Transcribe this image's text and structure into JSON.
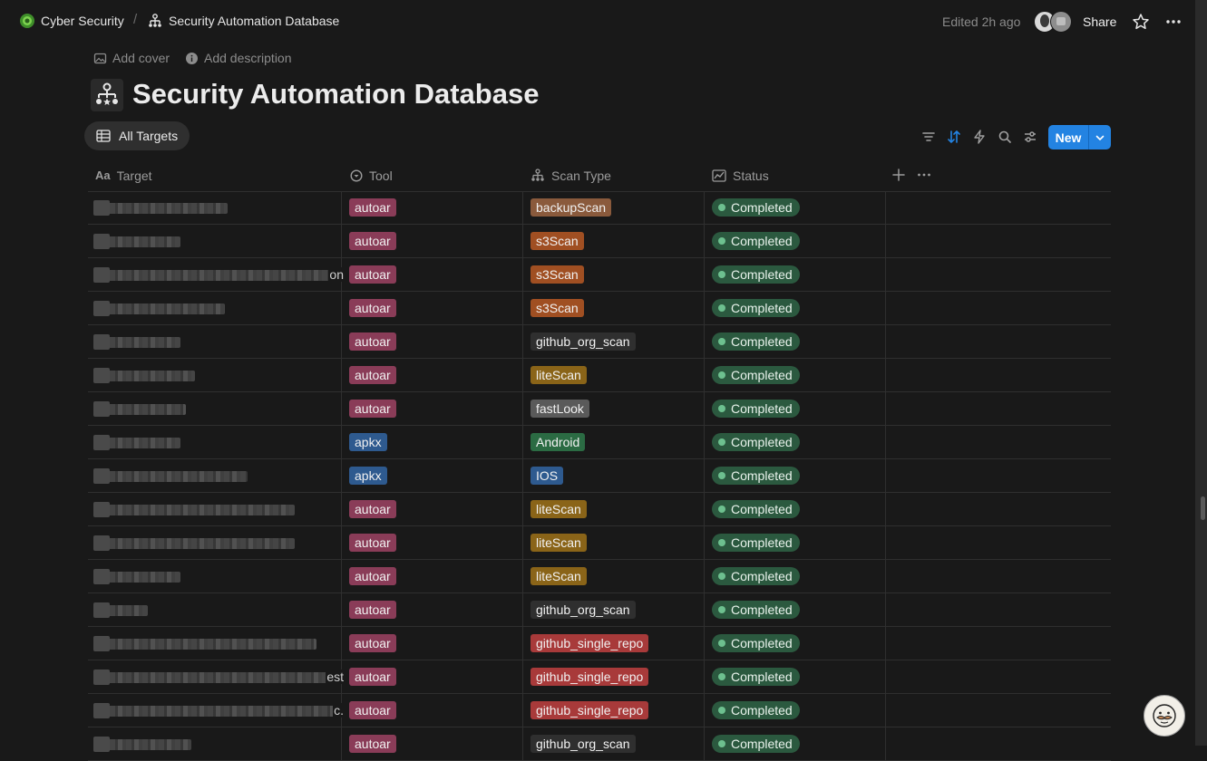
{
  "breadcrumb": {
    "workspace": "Cyber Security",
    "separator": "/",
    "page": "Security Automation Database"
  },
  "topbar": {
    "edited": "Edited 2h ago",
    "share": "Share"
  },
  "header": {
    "add_cover": "Add cover",
    "add_description": "Add description",
    "title": "Security Automation Database"
  },
  "view": {
    "tab_label": "All Targets",
    "new_label": "New"
  },
  "columns": {
    "target": "Target",
    "target_icon_text": "Aa",
    "tool": "Tool",
    "scan_type": "Scan Type",
    "status": "Status"
  },
  "colors": {
    "accent": "#2383e2",
    "tool_autoar": "#8a3c58",
    "tool_apkx": "#2e5a8f",
    "scan_brown": "#8a5a3c",
    "scan_orange": "#a04f22",
    "scan_gray": "#2f2f2f",
    "scan_yellow": "#8a6418",
    "scan_dark": "#5a5a5a",
    "scan_green": "#2b6b43",
    "scan_blue": "#2e5a8f",
    "scan_red": "#a83a3a",
    "status_green": "#2b593f"
  },
  "rows": [
    {
      "target_visible": "",
      "tool": "autoar",
      "tool_color": "tool_autoar",
      "scan": "backupScan",
      "scan_color": "scan_brown",
      "status": "Completed"
    },
    {
      "target_visible": "",
      "tool": "autoar",
      "tool_color": "tool_autoar",
      "scan": "s3Scan",
      "scan_color": "scan_orange",
      "status": "Completed"
    },
    {
      "target_visible": "on",
      "tool": "autoar",
      "tool_color": "tool_autoar",
      "scan": "s3Scan",
      "scan_color": "scan_orange",
      "status": "Completed"
    },
    {
      "target_visible": "",
      "tool": "autoar",
      "tool_color": "tool_autoar",
      "scan": "s3Scan",
      "scan_color": "scan_orange",
      "status": "Completed"
    },
    {
      "target_visible": "",
      "tool": "autoar",
      "tool_color": "tool_autoar",
      "scan": "github_org_scan",
      "scan_color": "scan_gray",
      "status": "Completed"
    },
    {
      "target_visible": "",
      "tool": "autoar",
      "tool_color": "tool_autoar",
      "scan": "liteScan",
      "scan_color": "scan_yellow",
      "status": "Completed"
    },
    {
      "target_visible": "",
      "tool": "autoar",
      "tool_color": "tool_autoar",
      "scan": "fastLook",
      "scan_color": "scan_dark",
      "status": "Completed"
    },
    {
      "target_visible": "",
      "tool": "apkx",
      "tool_color": "tool_apkx",
      "scan": "Android",
      "scan_color": "scan_green",
      "status": "Completed"
    },
    {
      "target_visible": "",
      "tool": "apkx",
      "tool_color": "tool_apkx",
      "scan": "IOS",
      "scan_color": "scan_blue",
      "status": "Completed"
    },
    {
      "target_visible": "",
      "tool": "autoar",
      "tool_color": "tool_autoar",
      "scan": "liteScan",
      "scan_color": "scan_yellow",
      "status": "Completed"
    },
    {
      "target_visible": "",
      "tool": "autoar",
      "tool_color": "tool_autoar",
      "scan": "liteScan",
      "scan_color": "scan_yellow",
      "status": "Completed"
    },
    {
      "target_visible": "",
      "tool": "autoar",
      "tool_color": "tool_autoar",
      "scan": "liteScan",
      "scan_color": "scan_yellow",
      "status": "Completed"
    },
    {
      "target_visible": "",
      "tool": "autoar",
      "tool_color": "tool_autoar",
      "scan": "github_org_scan",
      "scan_color": "scan_gray",
      "status": "Completed"
    },
    {
      "target_visible": "",
      "tool": "autoar",
      "tool_color": "tool_autoar",
      "scan": "github_single_repo",
      "scan_color": "scan_red",
      "status": "Completed"
    },
    {
      "target_visible": "est",
      "tool": "autoar",
      "tool_color": "tool_autoar",
      "scan": "github_single_repo",
      "scan_color": "scan_red",
      "status": "Completed"
    },
    {
      "target_visible": "c.",
      "tool": "autoar",
      "tool_color": "tool_autoar",
      "scan": "github_single_repo",
      "scan_color": "scan_red",
      "status": "Completed"
    },
    {
      "target_visible": "",
      "tool": "autoar",
      "tool_color": "tool_autoar",
      "scan": "github_org_scan",
      "scan_color": "scan_gray",
      "status": "Completed"
    }
  ]
}
